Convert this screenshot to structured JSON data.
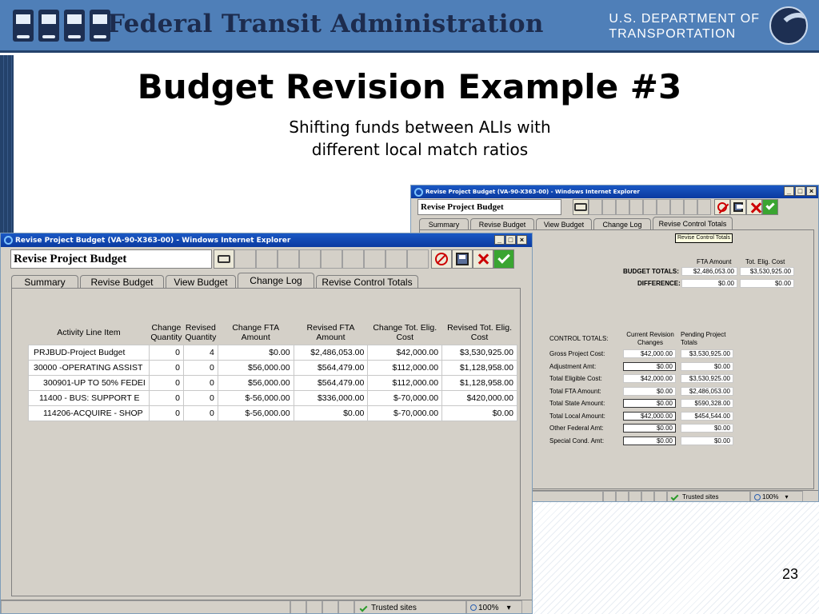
{
  "slide": {
    "agency": "Federal Transit Administration",
    "dot_line1": "U.S. DEPARTMENT OF",
    "dot_line2": "TRANSPORTATION",
    "title": "Budget Revision Example #3",
    "subtitle_line1": "Shifting funds between ALIs with",
    "subtitle_line2": "different local match ratios",
    "page_number": "23"
  },
  "back_window": {
    "title": "Revise Project Budget (VA-90-X363-00) - Windows Internet Explorer",
    "toolbar_title": "Revise Project Budget",
    "tabs": [
      "Summary",
      "Revise Budget",
      "View Budget",
      "Change Log",
      "Revise Control Totals"
    ],
    "tooltip": "Revise Control Totals",
    "budget_headers": [
      "FTA Amount",
      "Tot. Elig. Cost"
    ],
    "budget_totals_label": "BUDGET TOTALS:",
    "budget_totals": [
      "$2,486,053.00",
      "$3,530,925.00"
    ],
    "difference_label": "DIFFERENCE:",
    "difference": [
      "$0.00",
      "$0.00"
    ],
    "control_totals_label": "CONTROL TOTALS:",
    "ct_headers": [
      "Current Revision Changes",
      "Pending Project Totals"
    ],
    "control_rows": [
      {
        "label": "Gross Project Cost:",
        "current": "$42,000.00",
        "pending": "$3,530,925.00"
      },
      {
        "label": "Adjustment Amt:",
        "current": "$0.00",
        "pending": "$0.00"
      },
      {
        "label": "Total Eligible Cost:",
        "current": "$42,000.00",
        "pending": "$3,530,925.00"
      },
      {
        "label": "Total FTA Amount:",
        "current": "$0.00",
        "pending": "$2,486,053.00"
      },
      {
        "label": "Total State Amount:",
        "current": "$0.00",
        "pending": "$590,328.00"
      },
      {
        "label": "Total Local Amount:",
        "current": "$42,000.00",
        "pending": "$454,544.00"
      },
      {
        "label": "Other Federal Amt:",
        "current": "$0.00",
        "pending": "$0.00"
      },
      {
        "label": "Special Cond. Amt:",
        "current": "$0.00",
        "pending": "$0.00"
      }
    ],
    "status_text": "Trusted sites",
    "zoom": "100%"
  },
  "front_window": {
    "title": "Revise Project Budget (VA-90-X363-00) - Windows Internet Explorer",
    "toolbar_title": "Revise Project Budget",
    "tabs": [
      "Summary",
      "Revise Budget",
      "View Budget",
      "Change Log",
      "Revise Control Totals"
    ],
    "columns": [
      "Activity Line Item",
      "Change Quantity",
      "Revised Quantity",
      "Change FTA Amount",
      "Revised FTA Amount",
      "Change Tot. Elig. Cost",
      "Revised Tot. Elig. Cost"
    ],
    "rows": [
      [
        "PRJBUD-Project Budget",
        "0",
        "4",
        "$0.00",
        "$2,486,053.00",
        "$42,000.00",
        "$3,530,925.00"
      ],
      [
        "30000 -OPERATING ASSIST",
        "0",
        "0",
        "$56,000.00",
        "$564,479.00",
        "$112,000.00",
        "$1,128,958.00"
      ],
      [
        "300901-UP TO 50% FEDEI",
        "0",
        "0",
        "$56,000.00",
        "$564,479.00",
        "$112,000.00",
        "$1,128,958.00"
      ],
      [
        "11400 -  BUS:  SUPPORT E",
        "0",
        "0",
        "$-56,000.00",
        "$336,000.00",
        "$-70,000.00",
        "$420,000.00"
      ],
      [
        "114206-ACQUIRE - SHOP",
        "0",
        "0",
        "$-56,000.00",
        "$0.00",
        "$-70,000.00",
        "$0.00"
      ]
    ],
    "status_text": "Trusted sites",
    "zoom": "100%"
  }
}
